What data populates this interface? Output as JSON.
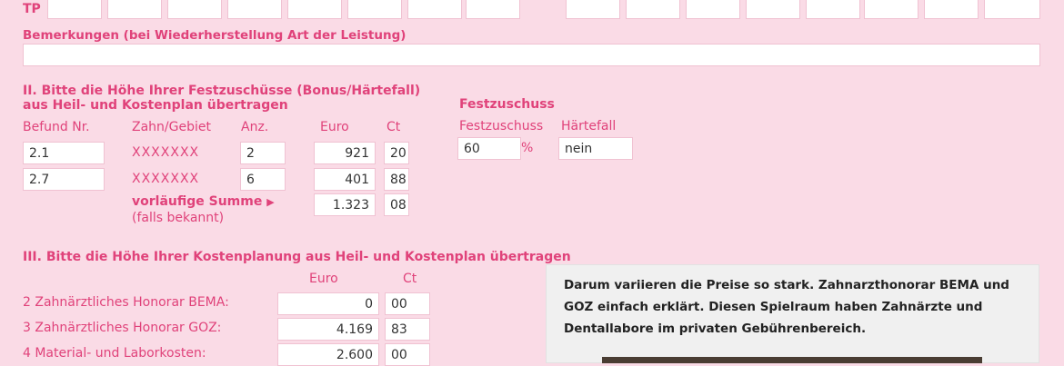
{
  "header": {
    "tp_label": "TP"
  },
  "bemerkungen": {
    "label": "Bemerkungen (bei Wiederherstellung Art der Leistung)",
    "value": ""
  },
  "section2": {
    "title_line1": "II. Bitte die Höhe Ihrer Festzuschüsse (Bonus/Härtefall)",
    "title_line2": "aus Heil- und Kostenplan übertragen",
    "col_befund": "Befund Nr.",
    "col_zahn": "Zahn/Gebiet",
    "col_anz": "Anz.",
    "col_euro": "Euro",
    "col_ct": "Ct",
    "rows": [
      {
        "befund": "2.1",
        "zahn": "XXXXXXX",
        "anz": "2",
        "euro": "921",
        "ct": "20"
      },
      {
        "befund": "2.7",
        "zahn": "XXXXXXX",
        "anz": "6",
        "euro": "401",
        "ct": "88"
      }
    ],
    "sum_label": "vorläufige Summe",
    "sum_hint": "(falls bekannt)",
    "sum_euro": "1.323",
    "sum_ct": "08",
    "festzuschuss_title": "Festzuschuss",
    "festzuschuss_label": "Festzuschuss",
    "haertefall_label": "Härtefall",
    "festzuschuss_value": "60",
    "percent": "%",
    "haertefall_value": "nein"
  },
  "section3": {
    "title": "III. Bitte die Höhe Ihrer Kostenplanung aus Heil- und Kostenplan übertragen",
    "col_euro": "Euro",
    "col_ct": "Ct",
    "rows": [
      {
        "label": "2 Zahnärztliches Honorar BEMA:",
        "euro": "0",
        "ct": "00"
      },
      {
        "label": "3 Zahnärztliches Honorar GOZ:",
        "euro": "4.169",
        "ct": "83"
      },
      {
        "label": "4 Material- und Laborkosten:",
        "euro": "2.600",
        "ct": "00"
      }
    ]
  },
  "info_card": {
    "text": "Darum variieren die Preise so stark. Zahnarzthonorar BEMA und GOZ einfach erklärt. Diesen Spielraum haben Zahnärzte und Dentallabore im privaten Gebührenbereich."
  },
  "colors": {
    "accent": "#e0427a",
    "background": "#fadbe6"
  }
}
